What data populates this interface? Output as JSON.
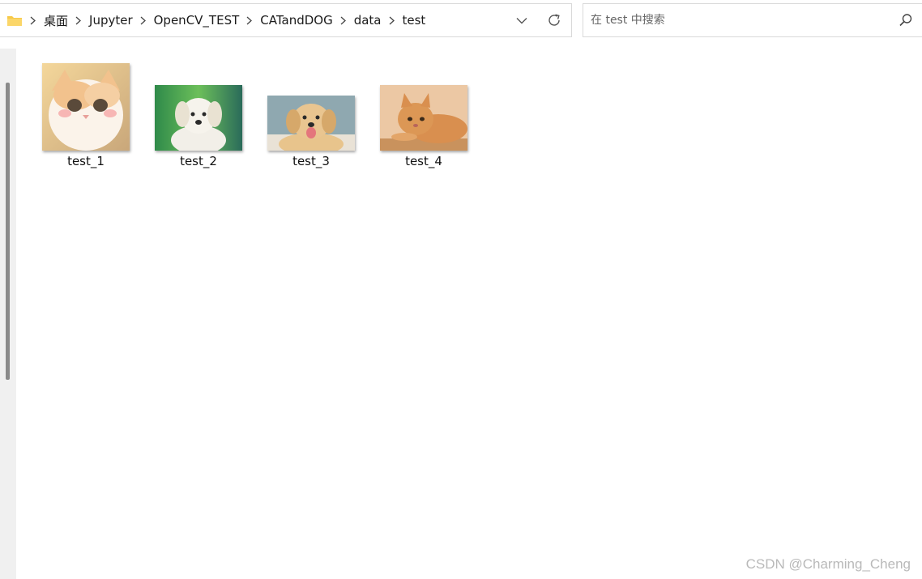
{
  "address_bar": {
    "crumbs": [
      "桌面",
      "Jupyter",
      "OpenCV_TEST",
      "CATandDOG",
      "data",
      "test"
    ]
  },
  "search": {
    "placeholder": "在 test 中搜索"
  },
  "files": [
    {
      "name": "test_1",
      "thumb": "cat-photo"
    },
    {
      "name": "test_2",
      "thumb": "dog-photo"
    },
    {
      "name": "test_3",
      "thumb": "dog-photo"
    },
    {
      "name": "test_4",
      "thumb": "cat-photo"
    }
  ],
  "watermark": "CSDN @Charming_Cheng",
  "icons": {
    "folder": "folder-icon",
    "chevron": "chevron-right-icon",
    "dropdown": "chevron-down-icon",
    "refresh": "refresh-icon",
    "search": "search-icon"
  },
  "colors": {
    "folder": "#f7c948",
    "border": "#d9d9d9"
  }
}
